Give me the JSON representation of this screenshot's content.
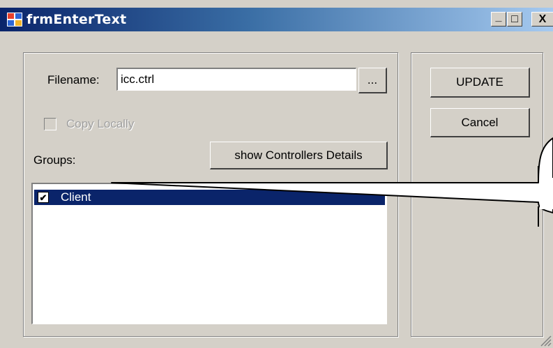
{
  "window": {
    "title": "frmEnterText",
    "minimize_glyph": "_",
    "maximize_glyph": "□",
    "close_glyph": "X"
  },
  "form": {
    "filename_label": "Filename:",
    "filename_value": "icc.ctrl",
    "browse_label": "...",
    "copy_locally_label": "Copy Locally",
    "copy_locally_checked": false,
    "copy_locally_enabled": false,
    "groups_label": "Groups:",
    "show_details_label": "show Controllers Details",
    "groups": [
      {
        "label": "Client",
        "checked": true,
        "selected": true
      }
    ]
  },
  "actions": {
    "update_label": "UPDATE",
    "cancel_label": "Cancel"
  },
  "icons": {
    "app": "app-form-icon",
    "check": "checkmark-icon",
    "resize": "resize-grip-icon"
  },
  "colors": {
    "titlebar_start": "#0a246a",
    "titlebar_end": "#a6caf0",
    "face": "#d4d0c8",
    "selection": "#0a246a"
  }
}
